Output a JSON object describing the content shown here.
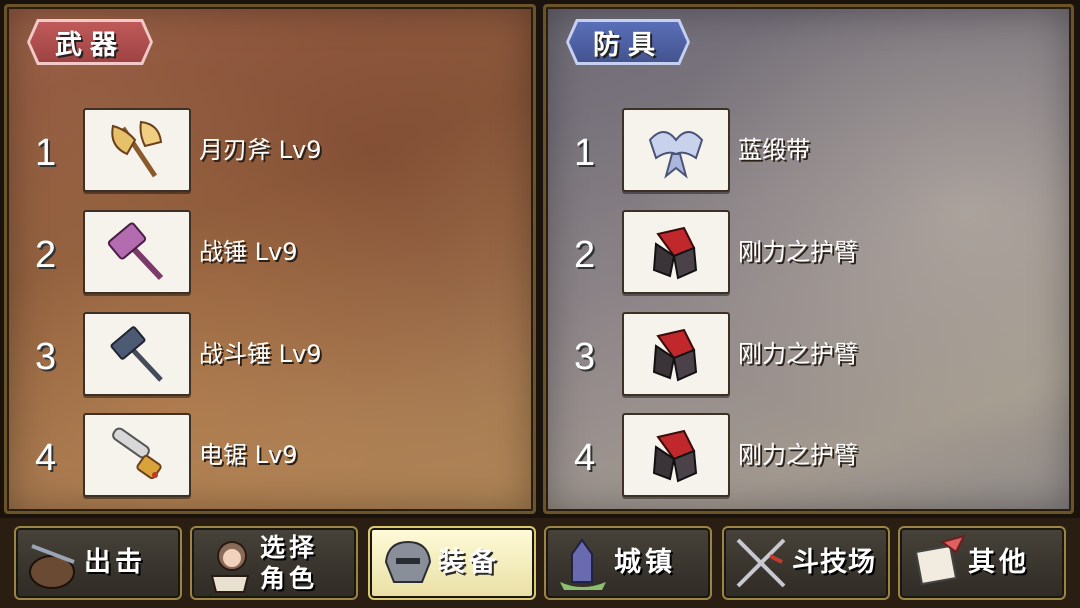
{
  "weapons": {
    "title": "武器",
    "items": [
      {
        "index": "1",
        "name": "月刃斧 Lv9",
        "icon": "moon-blade-axe-icon"
      },
      {
        "index": "2",
        "name": "战锤 Lv9",
        "icon": "war-hammer-icon"
      },
      {
        "index": "3",
        "name": "战斗锤 Lv9",
        "icon": "battle-hammer-icon"
      },
      {
        "index": "4",
        "name": "电锯 Lv9",
        "icon": "chainsaw-icon"
      }
    ]
  },
  "armor": {
    "title": "防具",
    "items": [
      {
        "index": "1",
        "name": "蓝缎带",
        "icon": "blue-ribbon-icon"
      },
      {
        "index": "2",
        "name": "刚力之护臂",
        "icon": "power-bracer-icon"
      },
      {
        "index": "3",
        "name": "刚力之护臂",
        "icon": "power-bracer-icon"
      },
      {
        "index": "4",
        "name": "刚力之护臂",
        "icon": "power-bracer-icon"
      }
    ]
  },
  "nav": {
    "sortie": "出击",
    "select_char_line1": "选择",
    "select_char_line2": "角色",
    "equip": "装备",
    "town": "城镇",
    "arena": "斗技场",
    "other": "其他",
    "active": "equip"
  },
  "colors": {
    "weapons_title": "#a84a4a",
    "armor_title": "#4d5f9e",
    "nav_active": "#f4edc0",
    "frame_gold": "#9a8546"
  }
}
